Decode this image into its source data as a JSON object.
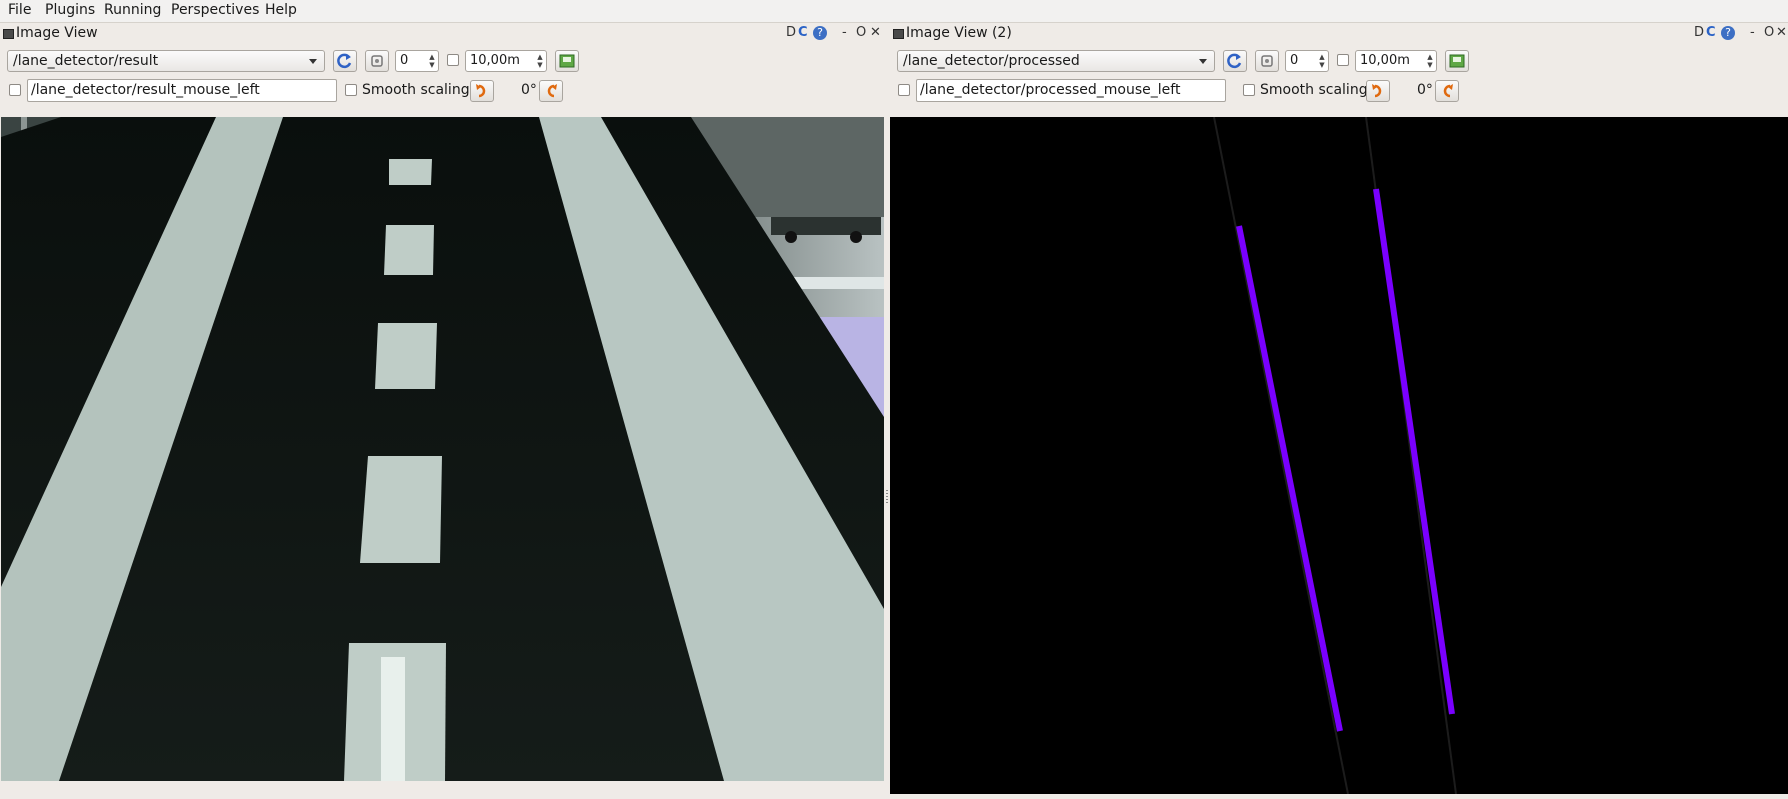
{
  "menubar": {
    "items": [
      "File",
      "Plugins",
      "Running",
      "Perspectives",
      "Help"
    ]
  },
  "panes": [
    {
      "title": "Image View",
      "topic": "/lane_detector/result",
      "spin_value": "0",
      "distance_value": "10,00m",
      "mouse_topic": "/lane_detector/result_mouse_left",
      "smooth_label": "Smooth scaling",
      "rotation": "0°",
      "title_buttons": [
        "D",
        "C",
        "?",
        "-",
        "O",
        "✕"
      ]
    },
    {
      "title": "Image View (2)",
      "topic": "/lane_detector/processed",
      "spin_value": "0",
      "distance_value": "10,00m",
      "mouse_topic": "/lane_detector/processed_mouse_left",
      "smooth_label": "Smooth scaling",
      "rotation": "0°",
      "title_buttons": [
        "D",
        "C",
        "?",
        "-",
        "O",
        "✕"
      ]
    }
  ],
  "colors": {
    "lane_line": "#7a00ff",
    "road": "#0d1410",
    "tape": "#c8d6d0"
  },
  "icons": [
    "refresh-icon",
    "save-image-icon",
    "rotate-left-icon",
    "rotate-right-icon",
    "window-icon"
  ]
}
